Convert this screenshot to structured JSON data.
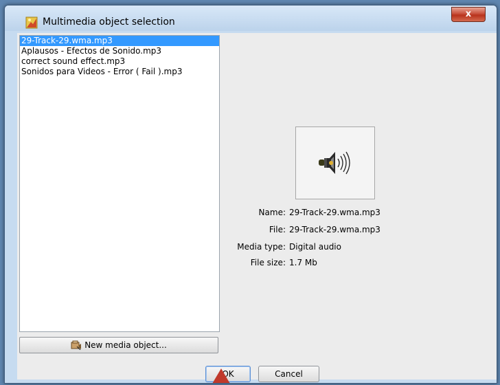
{
  "window": {
    "title": "Multimedia object selection",
    "close_label": "x"
  },
  "file_list": {
    "items": [
      {
        "label": "29-Track-29.wma.mp3",
        "selected": true
      },
      {
        "label": "Aplausos - Efectos de Sonido.mp3",
        "selected": false
      },
      {
        "label": "correct sound effect.mp3",
        "selected": false
      },
      {
        "label": "Sonidos para Videos - Error ( Fail ).mp3",
        "selected": false
      }
    ]
  },
  "new_media_button": {
    "label": "New media object...",
    "icon": "new-media-icon"
  },
  "preview": {
    "icon": "speaker-icon"
  },
  "details": {
    "name_label": "Name:",
    "name_value": "29-Track-29.wma.mp3",
    "file_label": "File:",
    "file_value": "29-Track-29.wma.mp3",
    "media_type_label": "Media type:",
    "media_type_value": "Digital audio",
    "file_size_label": "File size:",
    "file_size_value": "1.7 Mb"
  },
  "buttons": {
    "ok_label": "OK",
    "cancel_label": "Cancel"
  },
  "colors": {
    "selection": "#3399ff",
    "dialog_frame": "#c6dbf0",
    "close_button": "#c8503b"
  }
}
